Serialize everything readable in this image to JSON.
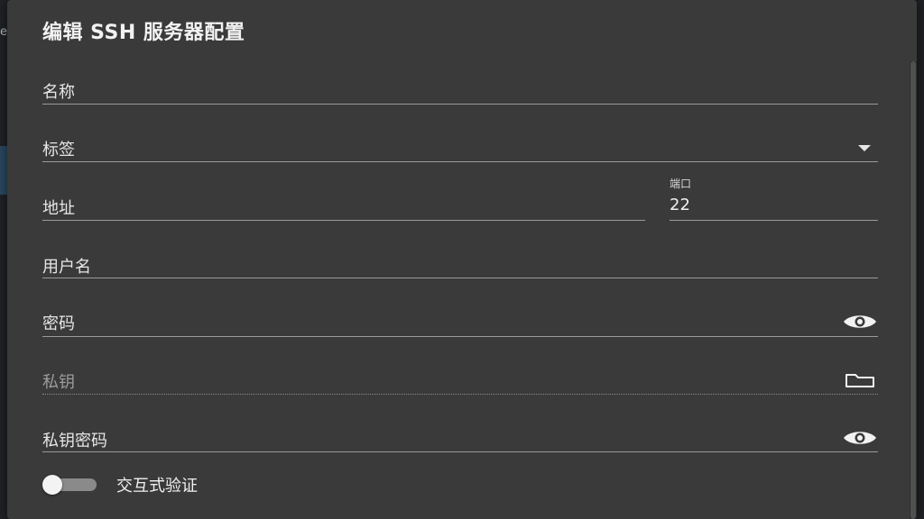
{
  "backdrop": {
    "edge_text": "e"
  },
  "dialog": {
    "title": "编辑 SSH 服务器配置"
  },
  "form": {
    "name": {
      "label": "名称",
      "value": ""
    },
    "tags": {
      "label": "标签",
      "value": "",
      "trailing_icon": "dropdown-arrow-icon"
    },
    "address": {
      "label": "地址",
      "value": ""
    },
    "port": {
      "label": "端口",
      "value": "22"
    },
    "username": {
      "label": "用户名",
      "value": ""
    },
    "password": {
      "label": "密码",
      "value": "",
      "trailing_icon": "eye-icon"
    },
    "private_key": {
      "label": "私钥",
      "value": "",
      "disabled": true,
      "trailing_icon": "folder-icon"
    },
    "passphrase": {
      "label": "私钥密码",
      "value": "",
      "trailing_icon": "eye-icon"
    }
  },
  "interactive_auth": {
    "label": "交互式验证",
    "enabled": false
  },
  "colors": {
    "dialog_background": "#3a3a3a",
    "underline": "#9a9a9a",
    "text": "#e6e6e6"
  }
}
